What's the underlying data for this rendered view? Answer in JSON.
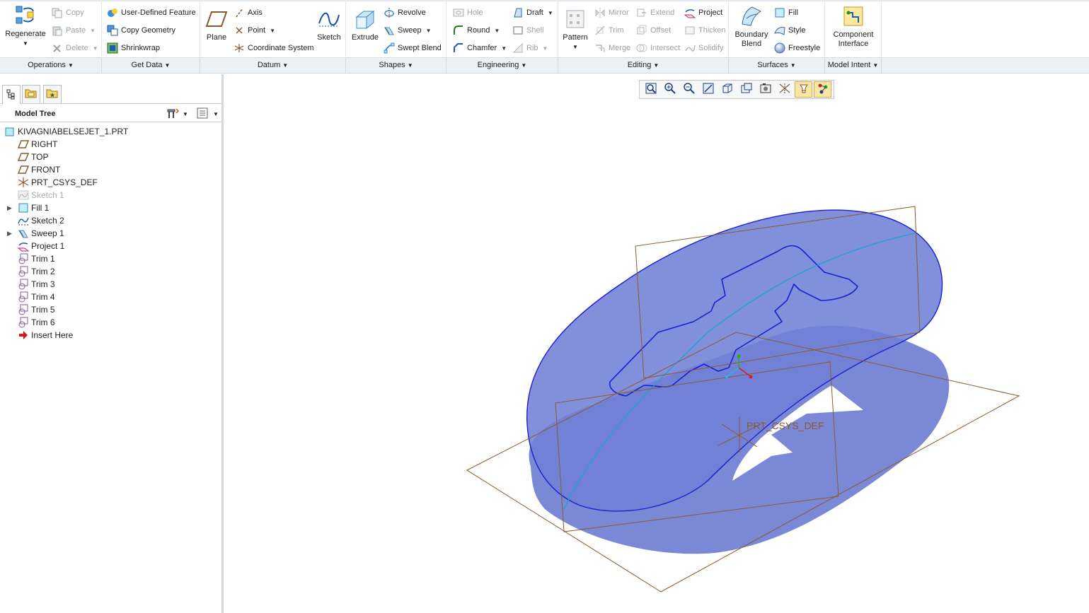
{
  "ribbon": {
    "groups": [
      {
        "id": "operations",
        "label": "Operations"
      },
      {
        "id": "getdata",
        "label": "Get Data"
      },
      {
        "id": "datum",
        "label": "Datum"
      },
      {
        "id": "shapes",
        "label": "Shapes"
      },
      {
        "id": "engineering",
        "label": "Engineering"
      },
      {
        "id": "editing",
        "label": "Editing"
      },
      {
        "id": "surfaces",
        "label": "Surfaces"
      },
      {
        "id": "modelintent",
        "label": "Model Intent"
      }
    ],
    "operations": {
      "regenerate": "Regenerate",
      "copy": "Copy",
      "paste": "Paste",
      "delete": "Delete"
    },
    "getdata": {
      "udf": "User-Defined Feature",
      "copy_geometry": "Copy Geometry",
      "shrinkwrap": "Shrinkwrap"
    },
    "datum": {
      "plane": "Plane",
      "axis": "Axis",
      "point": "Point",
      "csys": "Coordinate System",
      "sketch": "Sketch"
    },
    "shapes": {
      "extrude": "Extrude",
      "revolve": "Revolve",
      "sweep": "Sweep",
      "swept_blend": "Swept Blend"
    },
    "engineering": {
      "hole": "Hole",
      "round": "Round",
      "chamfer": "Chamfer",
      "draft": "Draft",
      "shell": "Shell",
      "rib": "Rib"
    },
    "editing": {
      "pattern": "Pattern",
      "mirror": "Mirror",
      "trim": "Trim",
      "merge": "Merge",
      "extend": "Extend",
      "offset": "Offset",
      "intersect": "Intersect",
      "project": "Project",
      "thicken": "Thicken",
      "solidify": "Solidify"
    },
    "surfaces": {
      "boundary_blend_1": "Boundary",
      "boundary_blend_2": "Blend",
      "fill": "Fill",
      "style": "Style",
      "freestyle": "Freestyle"
    },
    "modelintent": {
      "component_interface_1": "Component",
      "component_interface_2": "Interface"
    }
  },
  "model_tree": {
    "title": "Model Tree",
    "items": [
      {
        "label": "KIVAGNIABELSEJET_1.PRT",
        "icon": "part-icon",
        "expandable": false,
        "suppressed": false
      },
      {
        "label": "RIGHT",
        "icon": "datum-plane-icon",
        "expandable": false,
        "suppressed": false
      },
      {
        "label": "TOP",
        "icon": "datum-plane-icon",
        "expandable": false,
        "suppressed": false
      },
      {
        "label": "FRONT",
        "icon": "datum-plane-icon",
        "expandable": false,
        "suppressed": false
      },
      {
        "label": "PRT_CSYS_DEF",
        "icon": "csys-icon",
        "expandable": false,
        "suppressed": false
      },
      {
        "label": "Sketch 1",
        "icon": "sketch-icon",
        "expandable": false,
        "suppressed": true
      },
      {
        "label": "Fill 1",
        "icon": "fill-icon",
        "expandable": true,
        "suppressed": false
      },
      {
        "label": "Sketch 2",
        "icon": "sketch-icon",
        "expandable": false,
        "suppressed": false
      },
      {
        "label": "Sweep 1",
        "icon": "sweep-icon",
        "expandable": true,
        "suppressed": false
      },
      {
        "label": "Project 1",
        "icon": "project-icon",
        "expandable": false,
        "suppressed": false
      },
      {
        "label": "Trim 1",
        "icon": "trim-icon",
        "expandable": false,
        "suppressed": false
      },
      {
        "label": "Trim 2",
        "icon": "trim-icon",
        "expandable": false,
        "suppressed": false
      },
      {
        "label": "Trim 3",
        "icon": "trim-icon",
        "expandable": false,
        "suppressed": false
      },
      {
        "label": "Trim 4",
        "icon": "trim-icon",
        "expandable": false,
        "suppressed": false
      },
      {
        "label": "Trim 5",
        "icon": "trim-icon",
        "expandable": false,
        "suppressed": false
      },
      {
        "label": "Trim 6",
        "icon": "trim-icon",
        "expandable": false,
        "suppressed": false
      },
      {
        "label": "Insert Here",
        "icon": "insert-here-arrow-icon",
        "expandable": false,
        "suppressed": false
      }
    ]
  },
  "view_toolbar": {
    "buttons": [
      "refit-icon",
      "zoom-in-icon",
      "zoom-out-icon",
      "repaint-icon",
      "display-style-icon",
      "saved-views-icon",
      "view-manager-icon",
      "perspective-icon",
      "datum-display-filters-icon",
      "annotation-display-icon"
    ]
  },
  "viewport": {
    "csys_label": "PRT_CSYS_DEF",
    "surface_color": "#6f7fd6",
    "datum_plane_color": "#8b5a2b",
    "edge_color": "#1a1fd1",
    "trajectory_color": "#1aa3d8"
  }
}
